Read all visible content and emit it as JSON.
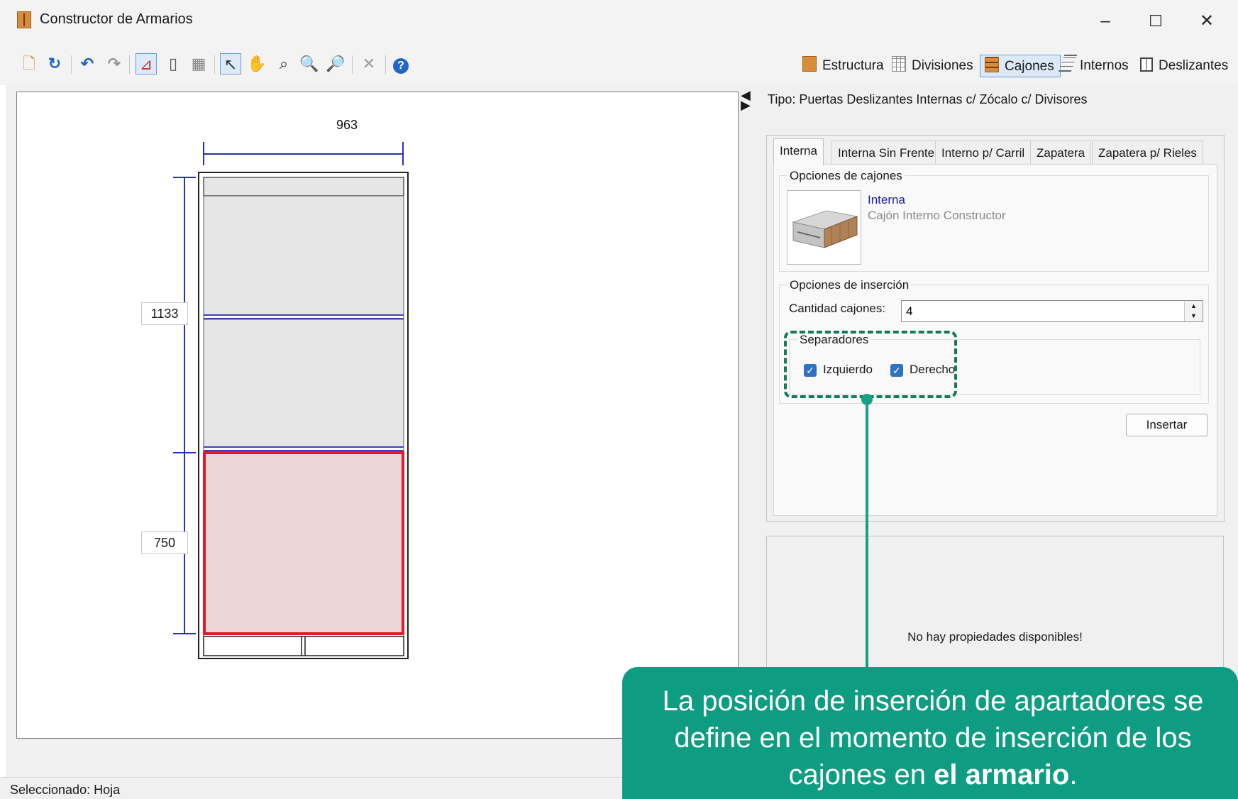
{
  "window": {
    "title": "Constructor de Armarios",
    "controls": {
      "minimize": "–",
      "maximize": "☐",
      "close": "✕"
    }
  },
  "toolbar": {
    "icons": [
      "new-icon",
      "refresh-icon",
      "undo-icon",
      "redo-icon",
      "draw-select-icon",
      "door-icon",
      "grid-icon",
      "pointer-icon",
      "pan-icon",
      "zoom-extents-icon",
      "zoom-out-icon",
      "zoom-in-icon",
      "delete-icon",
      "help-icon"
    ],
    "right_tabs": [
      {
        "label": "Estructura",
        "icon": "cabinet-icon"
      },
      {
        "label": "Divisiones",
        "icon": "grid-icon"
      },
      {
        "label": "Cajones",
        "icon": "drawer-icon",
        "active": true
      },
      {
        "label": "Internos",
        "icon": "shelves-icon"
      },
      {
        "label": "Deslizantes",
        "icon": "sliding-door-icon"
      }
    ]
  },
  "drawing": {
    "width_dim": "963",
    "height_dim_upper": "1133",
    "height_dim_lower": "750"
  },
  "panel": {
    "tipo": "Tipo: Puertas Deslizantes Internas c/ Zócalo c/ Divisores",
    "tabs": [
      "Interna",
      "Interna Sin Frente",
      "Interno p/ Carril",
      "Zapatera",
      "Zapatera p/ Rieles"
    ],
    "active_tab": "Interna",
    "opciones_cajones": {
      "title": "Opciones de cajones",
      "item_name": "Interna",
      "item_desc": "Cajón Interno Constructor"
    },
    "opciones_insercion": {
      "title": "Opciones de inserción",
      "cantidad_label": "Cantidad cajones:",
      "cantidad_value": "4",
      "separadores_title": "Separadores",
      "izquierdo_label": "Izquierdo",
      "izquierdo_checked": true,
      "derecho_label": "Derecho",
      "derecho_checked": true
    },
    "insertar_label": "Insertar",
    "props_message": "No hay propiedades disponibles!"
  },
  "status": {
    "text": "Seleccionado: Hoja"
  },
  "callout": {
    "text_before": "La posición de inserción de apartadores se define en el momento de inserción de los cajones en ",
    "text_bold": "el armario",
    "text_after": "."
  },
  "colors": {
    "accent_green": "#0e9d82",
    "selection_red": "#e01b2b",
    "dimension_blue": "#2b2fb8"
  }
}
